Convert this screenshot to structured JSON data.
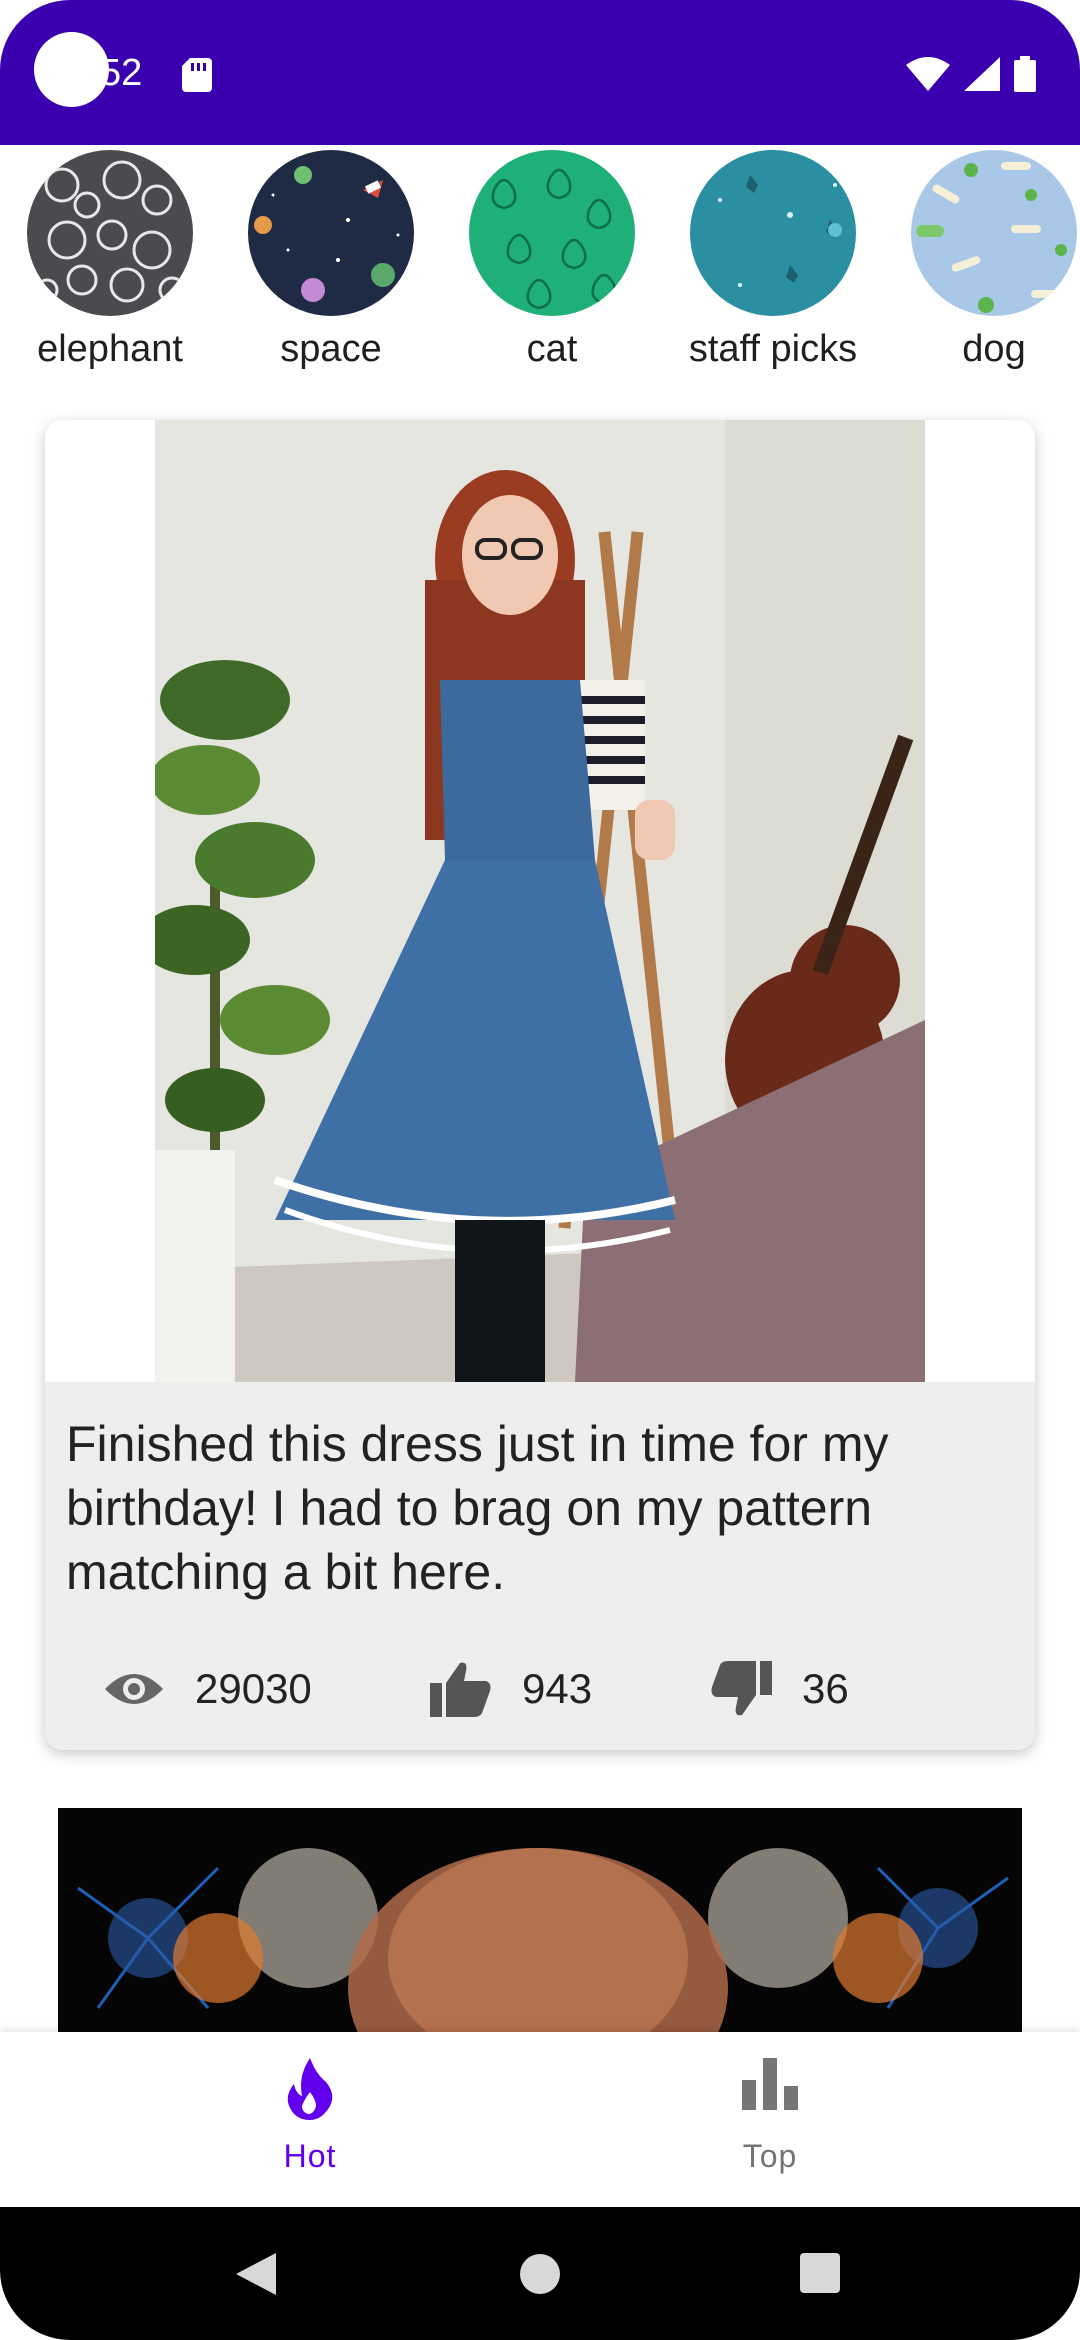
{
  "status_bar": {
    "time_fragment": "52",
    "colors": {
      "bar": "#3a00b0"
    }
  },
  "categories": [
    {
      "label": "elephant",
      "icon": "elephant-pattern-icon"
    },
    {
      "label": "space",
      "icon": "space-pattern-icon"
    },
    {
      "label": "cat",
      "icon": "cat-pattern-icon"
    },
    {
      "label": "staff picks",
      "icon": "staff-picks-pattern-icon"
    },
    {
      "label": "dog",
      "icon": "dog-pattern-icon"
    }
  ],
  "post": {
    "title": "Finished this dress just in time for my birthday! I had to brag on my pattern matching a bit here.",
    "views": "29030",
    "upvotes": "943",
    "downvotes": "36"
  },
  "bottom_nav": {
    "items": [
      {
        "label": "Hot",
        "icon": "flame-icon",
        "active": true
      },
      {
        "label": "Top",
        "icon": "bar-chart-icon",
        "active": false
      }
    ],
    "colors": {
      "active": "#6200ee",
      "inactive": "#757575"
    }
  }
}
